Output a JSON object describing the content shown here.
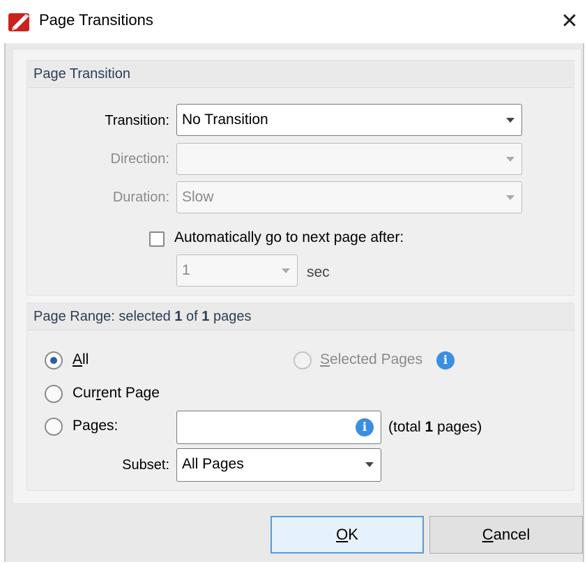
{
  "window": {
    "title": "Page Transitions",
    "close_glyph": "✕",
    "app_icon": "pdf-editor-icon"
  },
  "transition_group": {
    "title": "Page Transition",
    "transition_label": "Transition:",
    "transition_value": "No Transition",
    "direction_label": "Direction:",
    "direction_value": "",
    "duration_label": "Duration:",
    "duration_value": "Slow",
    "auto_next_label": "Automatically go to next page after:",
    "auto_next_checked": false,
    "seconds_value": "1",
    "seconds_unit": "sec"
  },
  "range_group": {
    "title_prefix": "Page Range: selected ",
    "selected_count": "1",
    "title_mid": " of ",
    "total_count": "1",
    "title_suffix": " pages",
    "all_label_accel": "A",
    "all_label_rest": "ll",
    "selected_pages_accel": "S",
    "selected_pages_rest": "elected Pages",
    "current_page_pre": "Cur",
    "current_page_accel": "r",
    "current_page_post": "ent Page",
    "pages_pre": "Pa",
    "pages_accel": "g",
    "pages_post": "es:",
    "pages_value": "",
    "total_prefix": "(total ",
    "total_pages": "1",
    "total_suffix": " pages)",
    "subset_label": "Subset:",
    "subset_value": "All Pages",
    "selected_option": "All"
  },
  "buttons": {
    "ok_accel": "O",
    "ok_rest": "K",
    "cancel_accel": "C",
    "cancel_rest": "ancel"
  },
  "colors": {
    "accent": "#2a5ca8",
    "info": "#3a8fe0",
    "default_button_border": "#5b9bd5"
  }
}
